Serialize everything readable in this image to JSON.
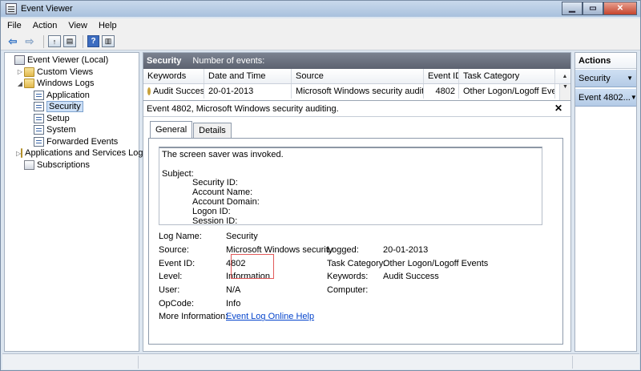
{
  "window": {
    "title": "Event Viewer"
  },
  "menu": [
    "File",
    "Action",
    "View",
    "Help"
  ],
  "tree": [
    {
      "label": "Event Viewer (Local)",
      "level": 0,
      "icon": "event-viewer-icon"
    },
    {
      "label": "Custom Views",
      "level": 1,
      "icon": "folder-icon",
      "arrow": "▷"
    },
    {
      "label": "Windows Logs",
      "level": 1,
      "icon": "folder-icon",
      "arrow": "◢"
    },
    {
      "label": "Application",
      "level": 2,
      "icon": "log-icon"
    },
    {
      "label": "Security",
      "level": 2,
      "icon": "log-icon",
      "selected": true
    },
    {
      "label": "Setup",
      "level": 2,
      "icon": "log-icon"
    },
    {
      "label": "System",
      "level": 2,
      "icon": "log-icon"
    },
    {
      "label": "Forwarded Events",
      "level": 2,
      "icon": "log-icon"
    },
    {
      "label": "Applications and Services Logs",
      "level": 1,
      "icon": "folder-icon",
      "arrow": "▷"
    },
    {
      "label": "Subscriptions",
      "level": 1,
      "icon": "subscription-icon"
    }
  ],
  "center": {
    "header": {
      "log_name": "Security",
      "events_label": "Number of events:"
    },
    "columns": [
      "Keywords",
      "Date and Time",
      "Source",
      "Event ID",
      "Task Category"
    ],
    "rows": [
      {
        "keywords": "Audit Success",
        "date": "20-01-2013",
        "source": "Microsoft Windows security auditing.",
        "event_id": "4802",
        "task": "Other Logon/Logoff Events"
      }
    ],
    "detail_title": "Event 4802, Microsoft Windows security auditing.",
    "tabs": [
      "General",
      "Details"
    ],
    "description": {
      "line1": "The screen saver was invoked.",
      "subject": "Subject:",
      "fields": [
        "Security ID:",
        "Account Name:",
        "Account Domain:",
        "Logon ID:",
        "Session ID:"
      ]
    },
    "props": {
      "log_name_label": "Log Name:",
      "log_name": "Security",
      "source_label": "Source:",
      "source": "Microsoft Windows security",
      "logged_label": "Logged:",
      "logged": "20-01-2013",
      "event_id_label": "Event ID:",
      "event_id": "4802",
      "task_label": "Task Category:",
      "task": "Other Logon/Logoff Events",
      "level_label": "Level:",
      "level": "Information",
      "keywords_label": "Keywords:",
      "keywords": "Audit Success",
      "user_label": "User:",
      "user": "N/A",
      "computer_label": "Computer:",
      "opcode_label": "OpCode:",
      "opcode": "Info",
      "more_label": "More Information:",
      "more_link": "Event Log Online Help"
    }
  },
  "actions": {
    "title": "Actions",
    "items": [
      "Security",
      "Event 4802..."
    ]
  }
}
